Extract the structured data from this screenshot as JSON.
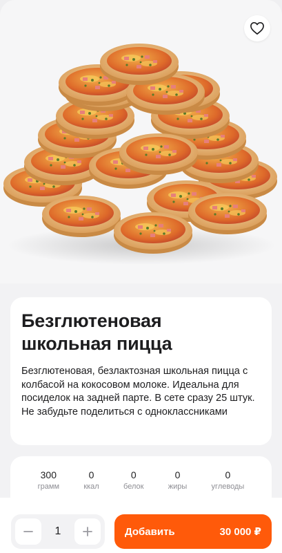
{
  "product": {
    "title_line1": "Безглютеновая",
    "title_line2": "школьная пицца",
    "description": "Безглютеновая, безлактозная школьная пицца с колбасой на кокосовом молоке. Идеальна для посиделок на задней парте. В сете сразу 25 штук. Не забудьте поделиться с одноклассниками",
    "image_alt": "pile-of-mini-pizzas"
  },
  "favorite": {
    "icon": "heart-icon"
  },
  "nutrition": [
    {
      "value": "300",
      "label": "грамм"
    },
    {
      "value": "0",
      "label": "ккал"
    },
    {
      "value": "0",
      "label": "белок"
    },
    {
      "value": "0",
      "label": "жиры"
    },
    {
      "value": "0",
      "label": "углеводы"
    }
  ],
  "cart": {
    "quantity": "1",
    "minus_icon": "minus-icon",
    "plus_icon": "plus-icon",
    "add_label": "Добавить",
    "price": "30 000 ₽"
  },
  "colors": {
    "accent": "#ff5a0a",
    "background": "#f2f2f4",
    "card": "#ffffff",
    "muted_text": "#8d8d93"
  }
}
